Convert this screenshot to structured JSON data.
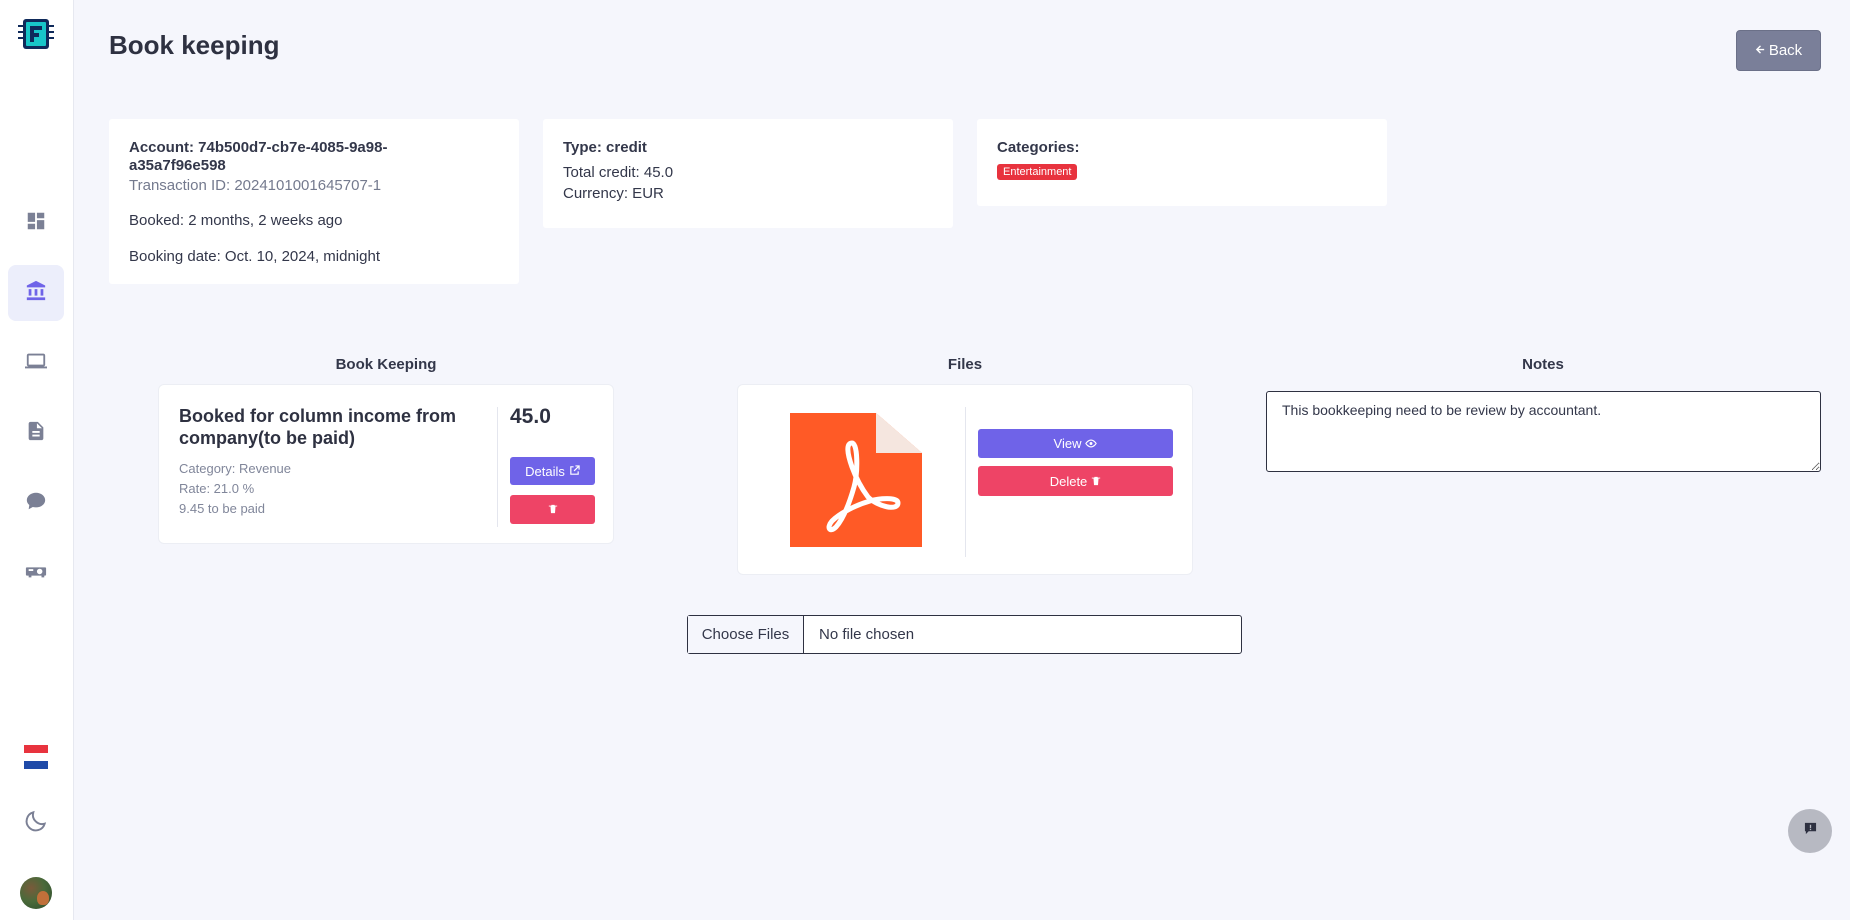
{
  "page": {
    "title": "Book keeping",
    "back_label": "Back"
  },
  "sidebar": {
    "items": [
      {
        "name": "dashboard",
        "icon": "dashboard-icon",
        "active": false
      },
      {
        "name": "bank",
        "icon": "bank-icon",
        "active": true
      },
      {
        "name": "devices",
        "icon": "laptop-icon",
        "active": false
      },
      {
        "name": "documents",
        "icon": "file-icon",
        "active": false
      },
      {
        "name": "chat",
        "icon": "chat-bubble-icon",
        "active": false
      },
      {
        "name": "projector",
        "icon": "projector-icon",
        "active": false
      }
    ],
    "language_icon": "netherlands-flag-icon",
    "theme_icon": "moon-icon"
  },
  "account_card": {
    "account": "Account: 74b500d7-cb7e-4085-9a98-a35a7f96e598",
    "transaction_id": "Transaction ID: 2024101001645707-1",
    "booked": "Booked: 2 months, 2 weeks ago",
    "booking_date": "Booking date: Oct. 10, 2024, midnight"
  },
  "type_card": {
    "type": "Type: credit",
    "total": "Total credit: 45.0",
    "currency": "Currency: EUR"
  },
  "categories_card": {
    "label": "Categories:",
    "badges": [
      "Entertainment"
    ]
  },
  "sections": {
    "book_keeping": "Book Keeping",
    "files": "Files",
    "notes": "Notes"
  },
  "book_entry": {
    "title": "Booked for column income from company(to be paid)",
    "category": "Category: Revenue",
    "rate": "Rate: 21.0 %",
    "to_be_paid": "9.45 to be paid",
    "amount": "45.0",
    "details_label": "Details"
  },
  "files": {
    "view_label": "View",
    "delete_label": "Delete"
  },
  "notes": {
    "value": "This bookkeeping need to be review by accountant."
  },
  "upload": {
    "button_label": "Choose Files",
    "status": "No file chosen"
  },
  "colors": {
    "primary": "#6f63e8",
    "danger": "#ee4466",
    "badge": "#e8333e",
    "back_button": "#7a7f99",
    "pdf": "#ff5a26"
  }
}
